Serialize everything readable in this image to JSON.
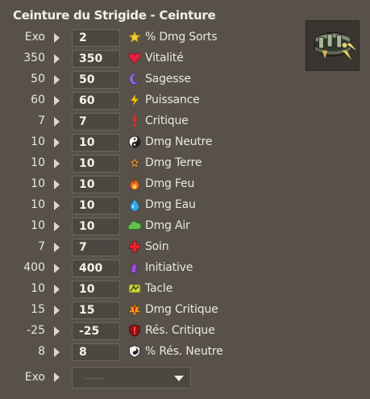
{
  "title": "Ceinture du Strigide - Ceinture",
  "item_image": "belt-item-image",
  "stats": [
    {
      "base": "Exo",
      "value": "2",
      "label": "% Dmg Sorts",
      "icon": "star-icon"
    },
    {
      "base": "350",
      "value": "350",
      "label": "Vitalité",
      "icon": "heart-icon"
    },
    {
      "base": "50",
      "value": "50",
      "label": "Sagesse",
      "icon": "moon-icon"
    },
    {
      "base": "60",
      "value": "60",
      "label": "Puissance",
      "icon": "lightning-icon"
    },
    {
      "base": "7",
      "value": "7",
      "label": "Critique",
      "icon": "exclamation-icon"
    },
    {
      "base": "10",
      "value": "10",
      "label": "Dmg Neutre",
      "icon": "yin-yang-icon"
    },
    {
      "base": "10",
      "value": "10",
      "label": "Dmg Terre",
      "icon": "earth-icon"
    },
    {
      "base": "10",
      "value": "10",
      "label": "Dmg Feu",
      "icon": "fire-icon"
    },
    {
      "base": "10",
      "value": "10",
      "label": "Dmg Eau",
      "icon": "water-drop-icon"
    },
    {
      "base": "10",
      "value": "10",
      "label": "Dmg Air",
      "icon": "air-cloud-icon"
    },
    {
      "base": "7",
      "value": "7",
      "label": "Soin",
      "icon": "heal-cross-icon"
    },
    {
      "base": "400",
      "value": "400",
      "label": "Initiative",
      "icon": "initiative-icon"
    },
    {
      "base": "10",
      "value": "10",
      "label": "Tacle",
      "icon": "tackle-icon"
    },
    {
      "base": "15",
      "value": "15",
      "label": "Dmg Critique",
      "icon": "critical-damage-icon"
    },
    {
      "base": "-25",
      "value": "-25",
      "label": "Rés. Critique",
      "icon": "critical-resistance-icon"
    },
    {
      "base": "8",
      "value": "8",
      "label": "% Rés. Neutre",
      "icon": "neutral-resistance-icon"
    }
  ],
  "exo": {
    "base": "Exo",
    "placeholder": "------",
    "icon": "chevron-down-icon"
  },
  "colors": {
    "background": "#57514a",
    "input_bg": "#4c4741",
    "input_border": "#6e675e",
    "text": "#ece7dc"
  }
}
